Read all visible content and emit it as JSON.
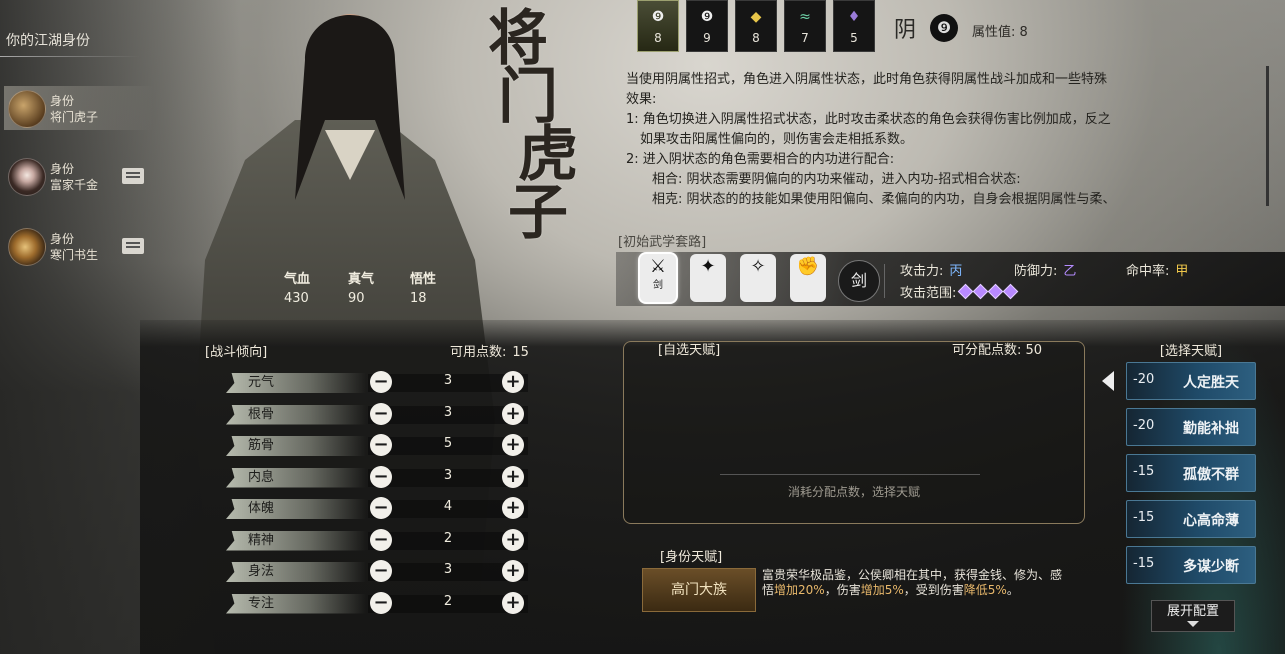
{
  "sidebar": {
    "title": "你的江湖身份",
    "items": [
      {
        "key": "身份",
        "value": "将门虎子",
        "icon": "warrior-portrait-icon",
        "locked": false
      },
      {
        "key": "身份",
        "value": "富家千金",
        "icon": "flower-icon",
        "locked": true
      },
      {
        "key": "身份",
        "value": "寒门书生",
        "icon": "scroll-icon",
        "locked": true
      }
    ]
  },
  "identity_title": [
    "将",
    "门",
    "虎",
    "子"
  ],
  "char_stats": [
    {
      "label": "气血",
      "value": "430"
    },
    {
      "label": "真气",
      "value": "90"
    },
    {
      "label": "悟性",
      "value": "18"
    }
  ],
  "combat": {
    "title": "[战斗倾向]",
    "avail_label": "可用点数:",
    "avail_value": "15",
    "attributes": [
      {
        "name": "元气",
        "value": "3"
      },
      {
        "name": "根骨",
        "value": "3"
      },
      {
        "name": "筋骨",
        "value": "5"
      },
      {
        "name": "内息",
        "value": "3"
      },
      {
        "name": "体魄",
        "value": "4"
      },
      {
        "name": "精神",
        "value": "2"
      },
      {
        "name": "身法",
        "value": "3"
      },
      {
        "name": "专注",
        "value": "2"
      }
    ],
    "minus": "−",
    "plus": "+"
  },
  "elements": {
    "tabs": [
      {
        "icon": "yin-swirl-icon",
        "glyph": "❾",
        "value": "8",
        "active": true
      },
      {
        "icon": "yang-swirl-icon",
        "glyph": "❾",
        "value": "9",
        "active": false
      },
      {
        "icon": "gold-ingot-icon",
        "glyph": "◆",
        "value": "8",
        "active": false
      },
      {
        "icon": "wind-icon",
        "glyph": "≈",
        "value": "7",
        "active": false
      },
      {
        "icon": "flame-icon",
        "glyph": "♦",
        "value": "5",
        "active": false
      }
    ],
    "current_label": "阴",
    "current_icon_glyph": "❾",
    "attr_value_label": "属性值:",
    "attr_value": "8"
  },
  "description": {
    "lines": [
      "当使用阴属性招式，角色进入阴属性状态，此时角色获得阴属性战斗加成和一些特殊",
      "效果:",
      "1: 角色切换进入阴属性招式状态，此时攻击柔状态的角色会获得伤害比例加成，反之",
      "如果攻击阳属性偏向的，则伤害会走相抵系数。",
      "2: 进入阴状态的角色需要相合的内功进行配合:",
      "相合: 阴状态需要阴偏向的内功来催动，进入内功-招式相合状态:",
      "相克: 阴状态的的技能如果使用阳偏向、柔偏向的内功，自身会根据阴属性与柔、"
    ]
  },
  "martial": {
    "title": "[初始武学套路]",
    "weapons": [
      {
        "icon": "sword-icon",
        "glyph": "⚔",
        "sub": "剑",
        "active": true
      },
      {
        "icon": "dagger-icon",
        "glyph": "✦",
        "sub": "",
        "active": false
      },
      {
        "icon": "spear-icon",
        "glyph": "✧",
        "sub": "",
        "active": false
      },
      {
        "icon": "fist-icon",
        "glyph": "✊",
        "sub": "",
        "active": false
      }
    ],
    "type_label": "剑",
    "stats": {
      "attack_label": "攻击力:",
      "attack_value": "丙",
      "defense_label": "防御力:",
      "defense_value": "乙",
      "hit_label": "命中率:",
      "hit_value": "甲",
      "range_label": "攻击范围:",
      "range_diamonds": 4
    },
    "colors": {
      "attack": "#7fb8ff",
      "defense": "#b58cff",
      "hit": "#f0c84a"
    }
  },
  "self_talent": {
    "title": "[自选天赋]",
    "avail_label": "可分配点数:",
    "avail_value": "50",
    "hint": "消耗分配点数，选择天赋"
  },
  "identity_talent": {
    "title": "[身份天赋]",
    "badge": "高门大族",
    "desc_parts": [
      {
        "text": "富贵荣华极品鉴，公侯卿相在其中，获得金钱、修为、感悟",
        "hl": false
      },
      {
        "text": "增加20%",
        "hl": true
      },
      {
        "text": "，伤害",
        "hl": false
      },
      {
        "text": "增加5%",
        "hl": true
      },
      {
        "text": "，受到伤害",
        "hl": false
      },
      {
        "text": "降低5%",
        "hl": true
      },
      {
        "text": "。",
        "hl": false
      }
    ]
  },
  "choose_talent": {
    "title": "[选择天赋]",
    "items": [
      {
        "cost": "-20",
        "name": "人定胜天"
      },
      {
        "cost": "-20",
        "name": "勤能补拙"
      },
      {
        "cost": "-15",
        "name": "孤傲不群"
      },
      {
        "cost": "-15",
        "name": "心高命薄"
      },
      {
        "cost": "-15",
        "name": "多谋少断"
      }
    ],
    "expand_label": "展开配置"
  }
}
